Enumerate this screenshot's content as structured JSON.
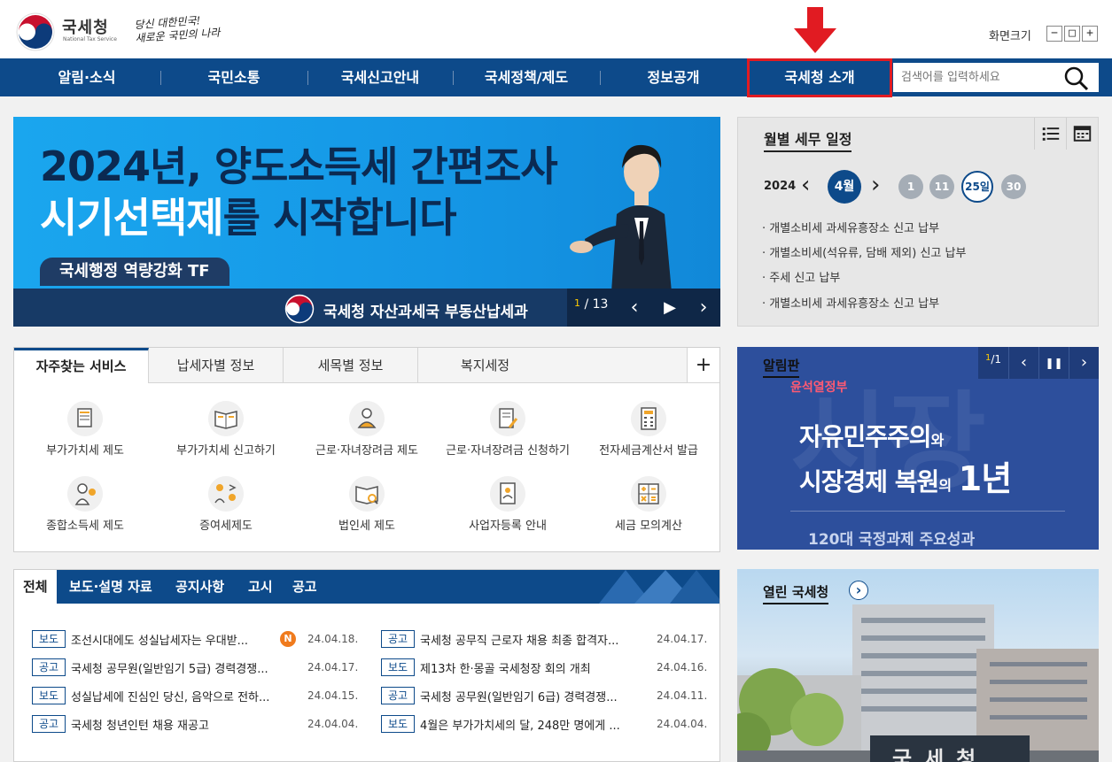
{
  "header": {
    "logo_text": "국세청",
    "logo_sub": "National Tax Service",
    "slogan_line1": "당신 대한민국!",
    "slogan_line2": "새로운 국민의 나라",
    "font_size_label": "화면크기",
    "font_minus": "−",
    "font_reset": "□",
    "font_plus": "+"
  },
  "nav": {
    "items": [
      "알림·소식",
      "국민소통",
      "국세신고안내",
      "국세정책/제도",
      "정보공개",
      "국세청 소개"
    ],
    "search_placeholder": "검색어를 입력하세요"
  },
  "banner": {
    "line1": "2024년, 양도소득세 간편조사",
    "line2_a": "시기선택제",
    "line2_b": "를 시작합니다",
    "tag": "국세행정 역량강화 TF",
    "org": "국세청 자산과세국 부동산납세과",
    "counter_current": "1",
    "counter_total": "/ 13",
    "prev": "‹",
    "play": "▶",
    "next": "›"
  },
  "calendar": {
    "title": "월별 세무 일정",
    "year": "2024",
    "month": "4월",
    "prev": "‹",
    "next": "›",
    "days": [
      "1",
      "11",
      "25일",
      "30"
    ],
    "items": [
      "· 개별소비세 과세유흥장소 신고 납부",
      "· 개별소비세(석유류, 담배 제외) 신고 납부",
      "· 주세 신고 납부",
      "· 개별소비세 과세유흥장소 신고 납부"
    ]
  },
  "services": {
    "tabs": [
      "자주찾는 서비스",
      "납세자별 정보",
      "세목별 정보",
      "복지세정"
    ],
    "plus": "+",
    "items": [
      "부가가치세 제도",
      "부가가치세 신고하기",
      "근로·자녀장려금 제도",
      "근로·자녀장려금 신청하기",
      "전자세금계산서 발급",
      "종합소득세 제도",
      "증여세제도",
      "법인세 제도",
      "사업자등록 안내",
      "세금 모의계산"
    ]
  },
  "board": {
    "title": "알림판",
    "counter_current": "1",
    "counter_total": "/1",
    "prev": "‹",
    "pause": "❚❚",
    "next": "›",
    "gov": "윤석열정부",
    "l1_a": "자유민주주의",
    "l1_b": "와",
    "l2_a": "시장경제 복원",
    "l2_b": "의",
    "l2_c": "1년",
    "foot": "120대 국정과제 주요성과",
    "bg_text": "시장"
  },
  "news": {
    "tabs": [
      "전체",
      "보도·설명 자료",
      "공지사항",
      "고시",
      "공고"
    ],
    "left": [
      {
        "tag": "보도",
        "title": "조선시대에도 성실납세자는 우대받...",
        "date": "24.04.18.",
        "badge": "N"
      },
      {
        "tag": "공고",
        "title": "국세청 공무원(일반임기 5급) 경력경쟁...",
        "date": "24.04.17."
      },
      {
        "tag": "보도",
        "title": "성실납세에 진심인 당신, 음악으로 전하...",
        "date": "24.04.15."
      },
      {
        "tag": "공고",
        "title": "국세청 청년인턴 채용 재공고",
        "date": "24.04.04."
      }
    ],
    "right": [
      {
        "tag": "공고",
        "title": "국세청 공무직 근로자 채용 최종 합격자...",
        "date": "24.04.17."
      },
      {
        "tag": "보도",
        "title": "제13차 한·몽골 국세청장 회의 개최",
        "date": "24.04.16."
      },
      {
        "tag": "공고",
        "title": "국세청 공무원(일반임기 6급) 경력경쟁...",
        "date": "24.04.11."
      },
      {
        "tag": "보도",
        "title": "4월은 부가가치세의 달, 248만 명에게 ...",
        "date": "24.04.04."
      }
    ]
  },
  "open": {
    "title": "열린 국세청",
    "arrow": "›",
    "sign": "국세청"
  },
  "colors": {
    "nav_blue": "#0d4a8a",
    "highlight_red": "#e11b22",
    "banner_blue": "#1597e6",
    "badge_orange": "#f07b1d"
  },
  "icons": [
    "search-icon",
    "list-icon",
    "calendar-icon",
    "red-down-arrow-icon",
    "nts-logo-icon"
  ]
}
